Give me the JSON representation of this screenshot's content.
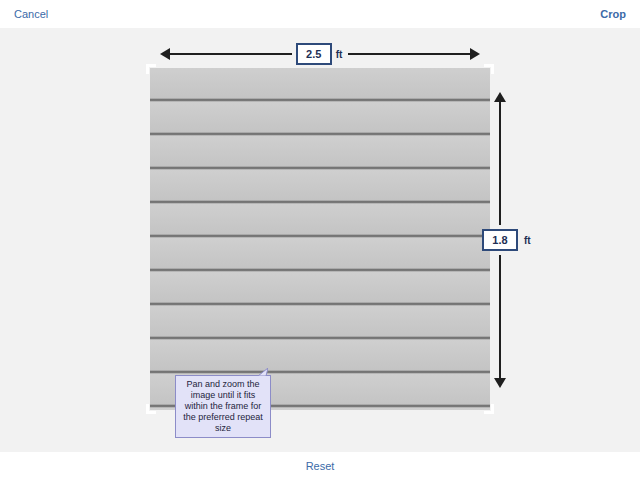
{
  "toolbar": {
    "cancel": "Cancel",
    "crop": "Crop"
  },
  "dimensions": {
    "width": {
      "value": "2.5",
      "unit": "ft"
    },
    "height": {
      "value": "1.8",
      "unit": "ft"
    }
  },
  "tooltip": "Pan and zoom the image until it fits within the frame for the preferred repeat size",
  "footer": {
    "reset": "Reset"
  }
}
